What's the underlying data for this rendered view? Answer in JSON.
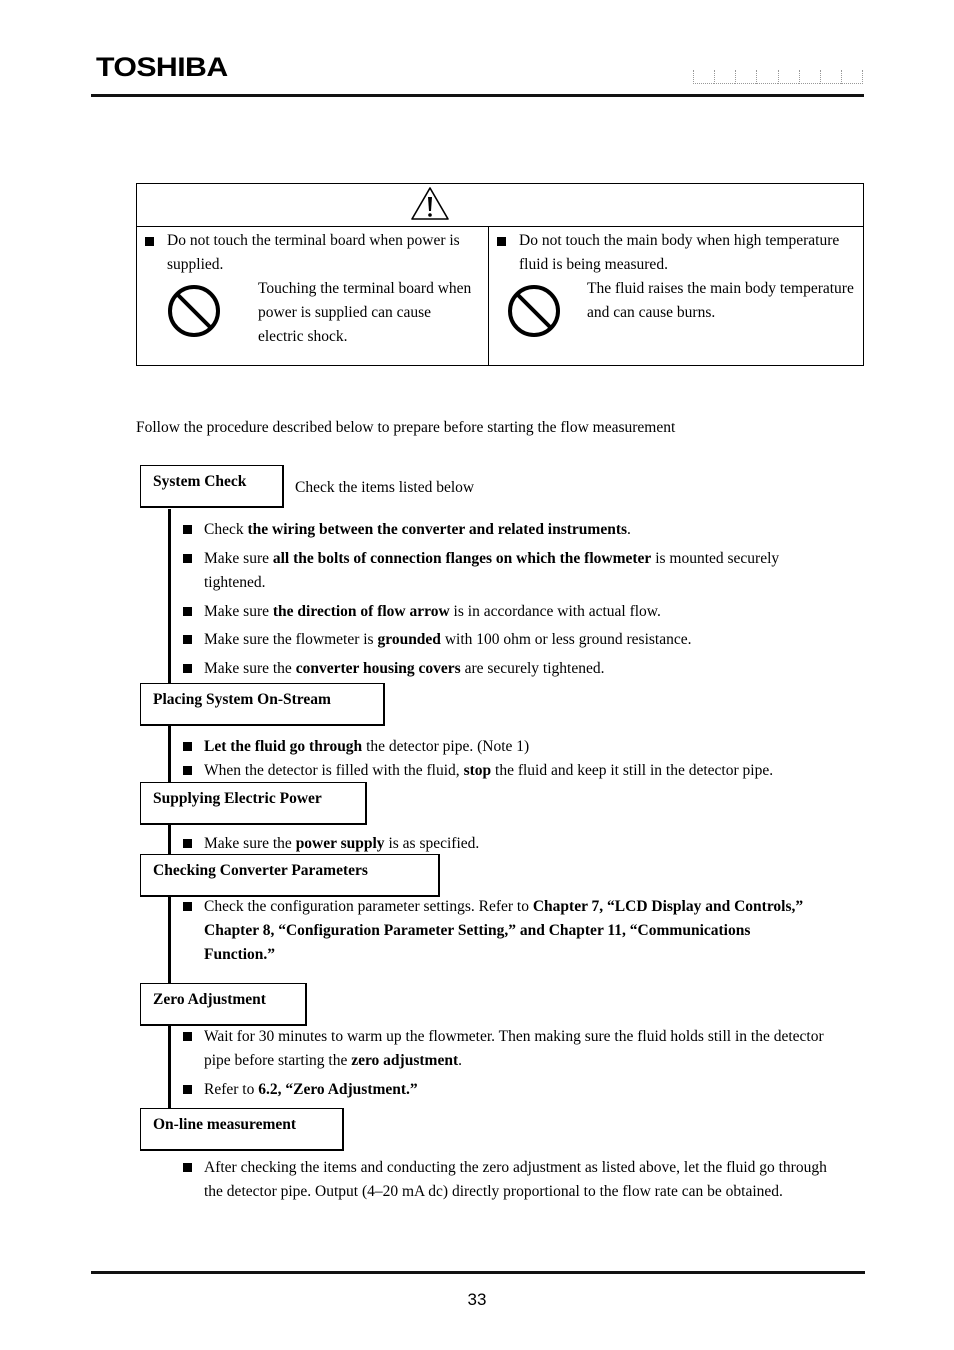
{
  "header": {
    "brand": "TOSHIBA",
    "doc_number_cells": 8
  },
  "caution": {
    "icon": "warning-triangle-icon",
    "left": {
      "statement": "Do not touch the terminal board when power is supplied.",
      "icon": "prohibition-icon",
      "description": "Touching the terminal board when power is supplied can cause electric shock."
    },
    "right": {
      "statement": "Do not touch the main body when high temperature fluid is being measured.",
      "icon": "prohibition-icon",
      "description": "The fluid raises the main body temperature and can cause burns."
    }
  },
  "intro": "Follow the procedure described below to prepare before starting the flow measurement",
  "steps": [
    {
      "title": "System Check",
      "note": "Check the items listed below",
      "items": [
        [
          {
            "t": "Check "
          },
          {
            "t": "the wiring between the converter and related instruments",
            "b": true
          },
          {
            "t": "."
          }
        ],
        [
          {
            "t": "Make sure "
          },
          {
            "t": "all the bolts of connection flanges on which the flowmeter",
            "b": true
          },
          {
            "t": " is mounted securely tightened."
          }
        ],
        [
          {
            "t": "Make sure "
          },
          {
            "t": "the direction of flow arrow",
            "b": true
          },
          {
            "t": " is in accordance with actual flow."
          }
        ],
        [
          {
            "t": "Make sure the flowmeter is "
          },
          {
            "t": "grounded",
            "b": true
          },
          {
            "t": " with 100 ohm or less ground resistance."
          }
        ],
        [
          {
            "t": "Make sure the "
          },
          {
            "t": "converter housing covers",
            "b": true
          },
          {
            "t": " are securely tightened."
          }
        ]
      ]
    },
    {
      "title": "Placing System On-Stream",
      "items": [
        [
          {
            "t": "Let the fluid go through",
            "b": true
          },
          {
            "t": " the detector pipe. (Note 1)"
          }
        ],
        [
          {
            "t": "When the detector is filled with the fluid, "
          },
          {
            "t": "stop",
            "b": true
          },
          {
            "t": " the fluid and keep it still in the detector pipe."
          }
        ]
      ]
    },
    {
      "title": "Supplying Electric Power",
      "items": [
        [
          {
            "t": "Make sure the "
          },
          {
            "t": "power supply",
            "b": true
          },
          {
            "t": " is as specified."
          }
        ]
      ]
    },
    {
      "title": "Checking Converter Parameters",
      "items": [
        [
          {
            "t": "Check the configuration parameter settings. Refer to "
          },
          {
            "t": "Chapter 7, “LCD Display and Controls,” Chapter 8, “Configuration Parameter Setting,” and Chapter 11, “Communications Function.”",
            "b": true
          }
        ]
      ]
    },
    {
      "title": "Zero Adjustment",
      "items": [
        [
          {
            "t": "Wait for 30 minutes to warm up the flowmeter. Then making sure the fluid holds still in the detector pipe before starting the "
          },
          {
            "t": "zero adjustment",
            "b": true
          },
          {
            "t": "."
          }
        ],
        [
          {
            "t": "Refer to "
          },
          {
            "t": "6.2, “Zero Adjustment.”",
            "b": true
          }
        ]
      ]
    },
    {
      "title": "On-line measurement",
      "items": [
        [
          {
            "t": "After checking the items and conducting the zero adjustment as listed above, let the fluid go through the detector pipe. Output (4–20 mA dc) directly proportional to the flow rate can be obtained."
          }
        ]
      ]
    }
  ],
  "footer": {
    "page_number": "33"
  }
}
